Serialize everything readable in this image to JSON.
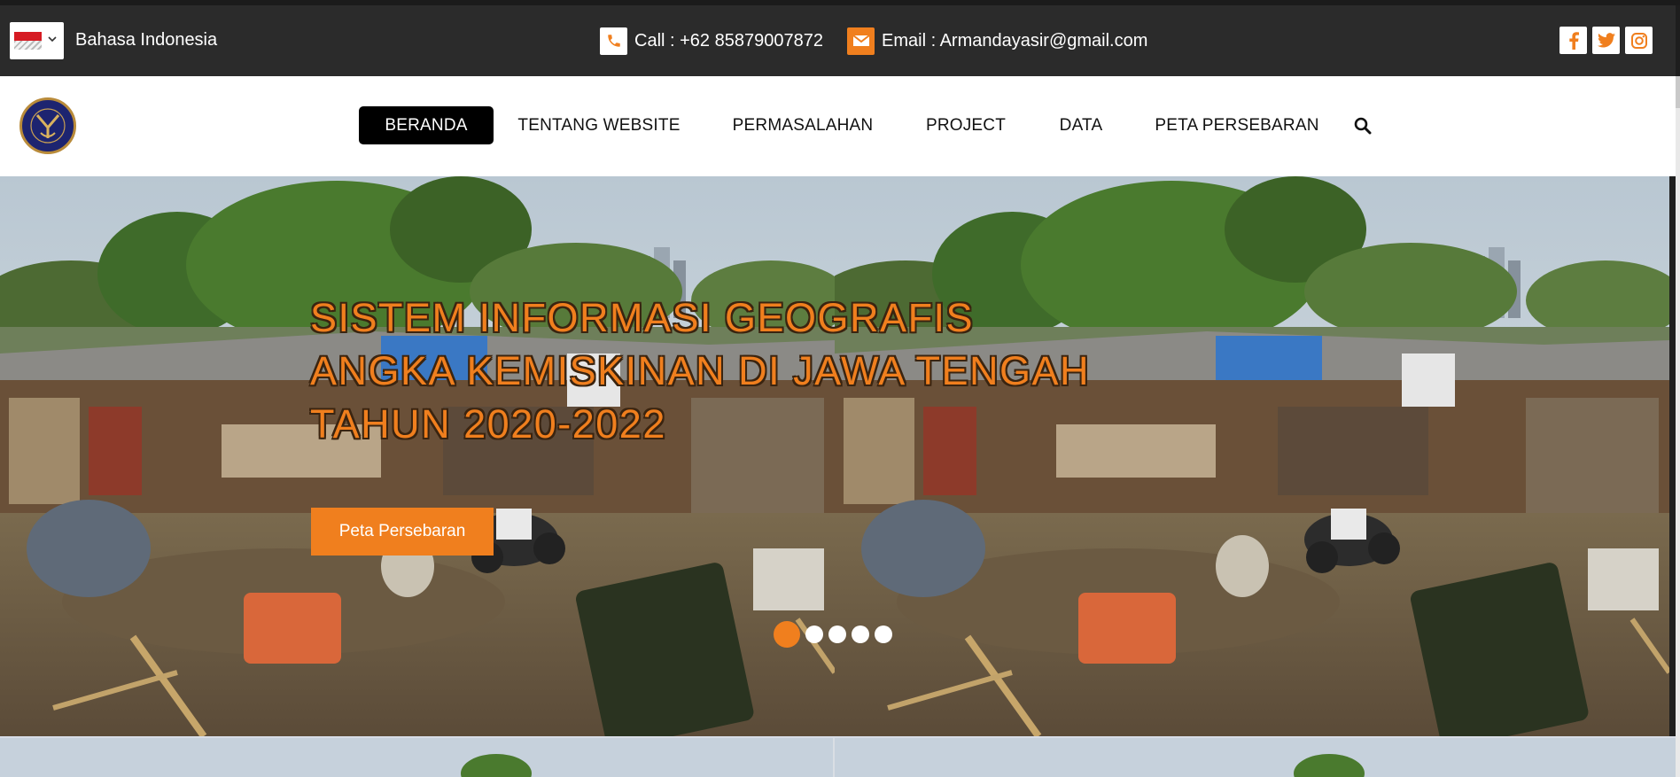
{
  "topbar": {
    "language_label": "Bahasa Indonesia",
    "call_text": "Call : +62 85879007872",
    "email_text": "Email : Armandayasir@gmail.com",
    "accent_color": "#f07f1e",
    "icons": [
      "phone-icon",
      "envelope-icon",
      "facebook-icon",
      "twitter-icon",
      "instagram-icon"
    ]
  },
  "nav": {
    "items": [
      {
        "label": "BERANDA",
        "active": true
      },
      {
        "label": "TENTANG WEBSITE",
        "active": false
      },
      {
        "label": "PERMASALAHAN",
        "active": false
      },
      {
        "label": "PROJECT",
        "active": false
      },
      {
        "label": "DATA",
        "active": false
      },
      {
        "label": "PETA PERSEBARAN",
        "active": false
      }
    ]
  },
  "hero": {
    "title_lines": [
      "SISTEM INFORMASI GEOGRAFIS",
      "ANGKA KEMISKINAN DI JAWA TENGAH",
      "TAHUN 2020-2022"
    ],
    "button_label": "Peta Persebaran",
    "slide_count": 5,
    "active_slide": 1
  },
  "colors": {
    "topbar_bg": "#2b2b2b",
    "accent": "#f07f1e",
    "nav_active_bg": "#000000"
  }
}
